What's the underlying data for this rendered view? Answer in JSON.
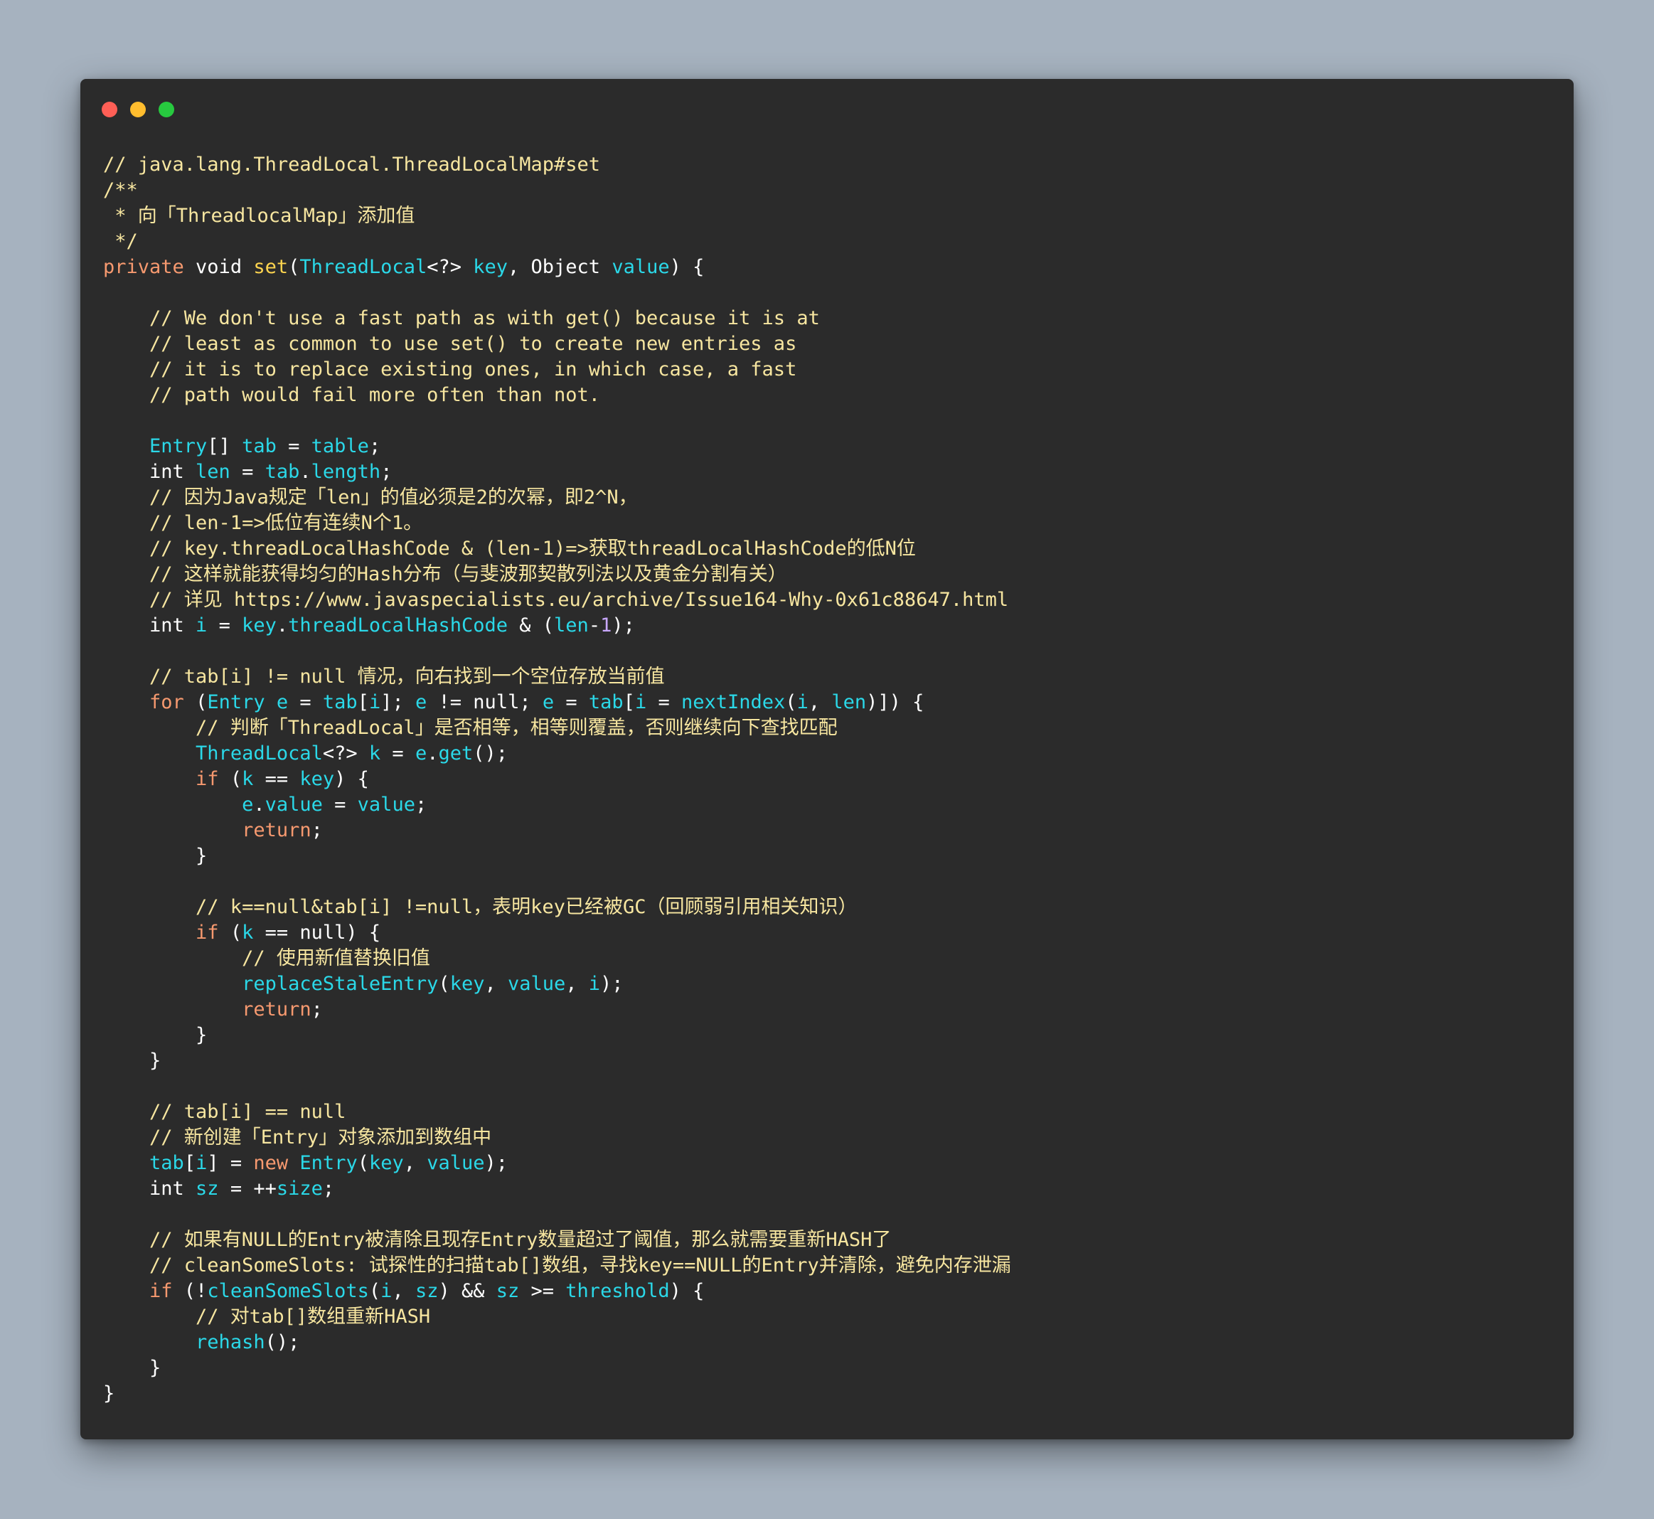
{
  "colors": {
    "background": "#a6b2bf",
    "editor": "#2b2b2b",
    "comment": "#f7e6a0",
    "keyword": "#f6996f",
    "function": "#ffd54f",
    "identifier": "#2bd8e8",
    "text": "#ffffff"
  },
  "window": {
    "buttons": [
      "close",
      "minimize",
      "zoom"
    ]
  },
  "code": {
    "lines": [
      [
        [
          "c",
          "// java.lang.ThreadLocal.ThreadLocalMap#set"
        ]
      ],
      [
        [
          "c",
          "/**"
        ]
      ],
      [
        [
          "c",
          " * 向「ThreadlocalMap」添加值"
        ]
      ],
      [
        [
          "c",
          " */"
        ]
      ],
      [
        [
          "kw",
          "private"
        ],
        [
          "tx",
          " void "
        ],
        [
          "fn",
          "set"
        ],
        [
          "tx",
          "("
        ],
        [
          "id",
          "ThreadLocal"
        ],
        [
          "tx",
          "<?> "
        ],
        [
          "id",
          "key"
        ],
        [
          "tx",
          ", Object "
        ],
        [
          "id",
          "value"
        ],
        [
          "tx",
          ") {"
        ]
      ],
      [
        [
          "tx",
          ""
        ]
      ],
      [
        [
          "c",
          "    // We don't use a fast path as with get() because it is at"
        ]
      ],
      [
        [
          "c",
          "    // least as common to use set() to create new entries as"
        ]
      ],
      [
        [
          "c",
          "    // it is to replace existing ones, in which case, a fast"
        ]
      ],
      [
        [
          "c",
          "    // path would fail more often than not."
        ]
      ],
      [
        [
          "tx",
          ""
        ]
      ],
      [
        [
          "tx",
          "    "
        ],
        [
          "id",
          "Entry"
        ],
        [
          "tx",
          "[] "
        ],
        [
          "id",
          "tab"
        ],
        [
          "tx",
          " = "
        ],
        [
          "id",
          "table"
        ],
        [
          "tx",
          ";"
        ]
      ],
      [
        [
          "tx",
          "    int "
        ],
        [
          "id",
          "len"
        ],
        [
          "tx",
          " = "
        ],
        [
          "id",
          "tab"
        ],
        [
          "tx",
          "."
        ],
        [
          "id",
          "length"
        ],
        [
          "tx",
          ";"
        ]
      ],
      [
        [
          "c",
          "    // 因为Java规定「len」的值必须是2的次幂，即2^N，"
        ]
      ],
      [
        [
          "c",
          "    // len-1=>低位有连续N个1。"
        ]
      ],
      [
        [
          "c",
          "    // key.threadLocalHashCode & (len-1)=>获取threadLocalHashCode的低N位"
        ]
      ],
      [
        [
          "c",
          "    // 这样就能获得均匀的Hash分布（与斐波那契散列法以及黄金分割有关）"
        ]
      ],
      [
        [
          "c",
          "    // 详见 https://www.javaspecialists.eu/archive/Issue164-Why-0x61c88647.html"
        ]
      ],
      [
        [
          "tx",
          "    int "
        ],
        [
          "id",
          "i"
        ],
        [
          "tx",
          " = "
        ],
        [
          "id",
          "key"
        ],
        [
          "tx",
          "."
        ],
        [
          "id",
          "threadLocalHashCode"
        ],
        [
          "tx",
          " & ("
        ],
        [
          "id",
          "len"
        ],
        [
          "tx",
          "-"
        ],
        [
          "num",
          "1"
        ],
        [
          "tx",
          ");"
        ]
      ],
      [
        [
          "tx",
          ""
        ]
      ],
      [
        [
          "c",
          "    // tab[i] != null 情况，向右找到一个空位存放当前值"
        ]
      ],
      [
        [
          "tx",
          "    "
        ],
        [
          "kw",
          "for"
        ],
        [
          "tx",
          " ("
        ],
        [
          "id",
          "Entry"
        ],
        [
          "tx",
          " "
        ],
        [
          "id",
          "e"
        ],
        [
          "tx",
          " = "
        ],
        [
          "id",
          "tab"
        ],
        [
          "tx",
          "["
        ],
        [
          "id",
          "i"
        ],
        [
          "tx",
          "]; "
        ],
        [
          "id",
          "e"
        ],
        [
          "tx",
          " != null; "
        ],
        [
          "id",
          "e"
        ],
        [
          "tx",
          " = "
        ],
        [
          "id",
          "tab"
        ],
        [
          "tx",
          "["
        ],
        [
          "id",
          "i"
        ],
        [
          "tx",
          " = "
        ],
        [
          "id",
          "nextIndex"
        ],
        [
          "tx",
          "("
        ],
        [
          "id",
          "i"
        ],
        [
          "tx",
          ", "
        ],
        [
          "id",
          "len"
        ],
        [
          "tx",
          ")]) {"
        ]
      ],
      [
        [
          "c",
          "        // 判断「ThreadLocal」是否相等，相等则覆盖，否则继续向下查找匹配"
        ]
      ],
      [
        [
          "tx",
          "        "
        ],
        [
          "id",
          "ThreadLocal"
        ],
        [
          "tx",
          "<?> "
        ],
        [
          "id",
          "k"
        ],
        [
          "tx",
          " = "
        ],
        [
          "id",
          "e"
        ],
        [
          "tx",
          "."
        ],
        [
          "id",
          "get"
        ],
        [
          "tx",
          "();"
        ]
      ],
      [
        [
          "tx",
          "        "
        ],
        [
          "kw",
          "if"
        ],
        [
          "tx",
          " ("
        ],
        [
          "id",
          "k"
        ],
        [
          "tx",
          " == "
        ],
        [
          "id",
          "key"
        ],
        [
          "tx",
          ") {"
        ]
      ],
      [
        [
          "tx",
          "            "
        ],
        [
          "id",
          "e"
        ],
        [
          "tx",
          "."
        ],
        [
          "id",
          "value"
        ],
        [
          "tx",
          " = "
        ],
        [
          "id",
          "value"
        ],
        [
          "tx",
          ";"
        ]
      ],
      [
        [
          "tx",
          "            "
        ],
        [
          "kw",
          "return"
        ],
        [
          "tx",
          ";"
        ]
      ],
      [
        [
          "tx",
          "        }"
        ]
      ],
      [
        [
          "tx",
          ""
        ]
      ],
      [
        [
          "c",
          "        // k==null&tab[i] !=null，表明key已经被GC（回顾弱引用相关知识）"
        ]
      ],
      [
        [
          "tx",
          "        "
        ],
        [
          "kw",
          "if"
        ],
        [
          "tx",
          " ("
        ],
        [
          "id",
          "k"
        ],
        [
          "tx",
          " == null) {"
        ]
      ],
      [
        [
          "c",
          "            // 使用新值替换旧值"
        ]
      ],
      [
        [
          "tx",
          "            "
        ],
        [
          "id",
          "replaceStaleEntry"
        ],
        [
          "tx",
          "("
        ],
        [
          "id",
          "key"
        ],
        [
          "tx",
          ", "
        ],
        [
          "id",
          "value"
        ],
        [
          "tx",
          ", "
        ],
        [
          "id",
          "i"
        ],
        [
          "tx",
          ");"
        ]
      ],
      [
        [
          "tx",
          "            "
        ],
        [
          "kw",
          "return"
        ],
        [
          "tx",
          ";"
        ]
      ],
      [
        [
          "tx",
          "        }"
        ]
      ],
      [
        [
          "tx",
          "    }"
        ]
      ],
      [
        [
          "tx",
          ""
        ]
      ],
      [
        [
          "c",
          "    // tab[i] == null"
        ]
      ],
      [
        [
          "c",
          "    // 新创建「Entry」对象添加到数组中"
        ]
      ],
      [
        [
          "tx",
          "    "
        ],
        [
          "id",
          "tab"
        ],
        [
          "tx",
          "["
        ],
        [
          "id",
          "i"
        ],
        [
          "tx",
          "] = "
        ],
        [
          "kw",
          "new"
        ],
        [
          "tx",
          " "
        ],
        [
          "id",
          "Entry"
        ],
        [
          "tx",
          "("
        ],
        [
          "id",
          "key"
        ],
        [
          "tx",
          ", "
        ],
        [
          "id",
          "value"
        ],
        [
          "tx",
          ");"
        ]
      ],
      [
        [
          "tx",
          "    int "
        ],
        [
          "id",
          "sz"
        ],
        [
          "tx",
          " = ++"
        ],
        [
          "id",
          "size"
        ],
        [
          "tx",
          ";"
        ]
      ],
      [
        [
          "tx",
          ""
        ]
      ],
      [
        [
          "c",
          "    // 如果有NULL的Entry被清除且现存Entry数量超过了阈值，那么就需要重新HASH了"
        ]
      ],
      [
        [
          "c",
          "    // cleanSomeSlots: 试探性的扫描tab[]数组，寻找key==NULL的Entry并清除，避免内存泄漏"
        ]
      ],
      [
        [
          "tx",
          "    "
        ],
        [
          "kw",
          "if"
        ],
        [
          "tx",
          " (!"
        ],
        [
          "id",
          "cleanSomeSlots"
        ],
        [
          "tx",
          "("
        ],
        [
          "id",
          "i"
        ],
        [
          "tx",
          ", "
        ],
        [
          "id",
          "sz"
        ],
        [
          "tx",
          ") && "
        ],
        [
          "id",
          "sz"
        ],
        [
          "tx",
          " >= "
        ],
        [
          "id",
          "threshold"
        ],
        [
          "tx",
          ") {"
        ]
      ],
      [
        [
          "c",
          "        // 对tab[]数组重新HASH"
        ]
      ],
      [
        [
          "tx",
          "        "
        ],
        [
          "id",
          "rehash"
        ],
        [
          "tx",
          "();"
        ]
      ],
      [
        [
          "tx",
          "    }"
        ]
      ],
      [
        [
          "tx",
          "}"
        ]
      ]
    ]
  }
}
